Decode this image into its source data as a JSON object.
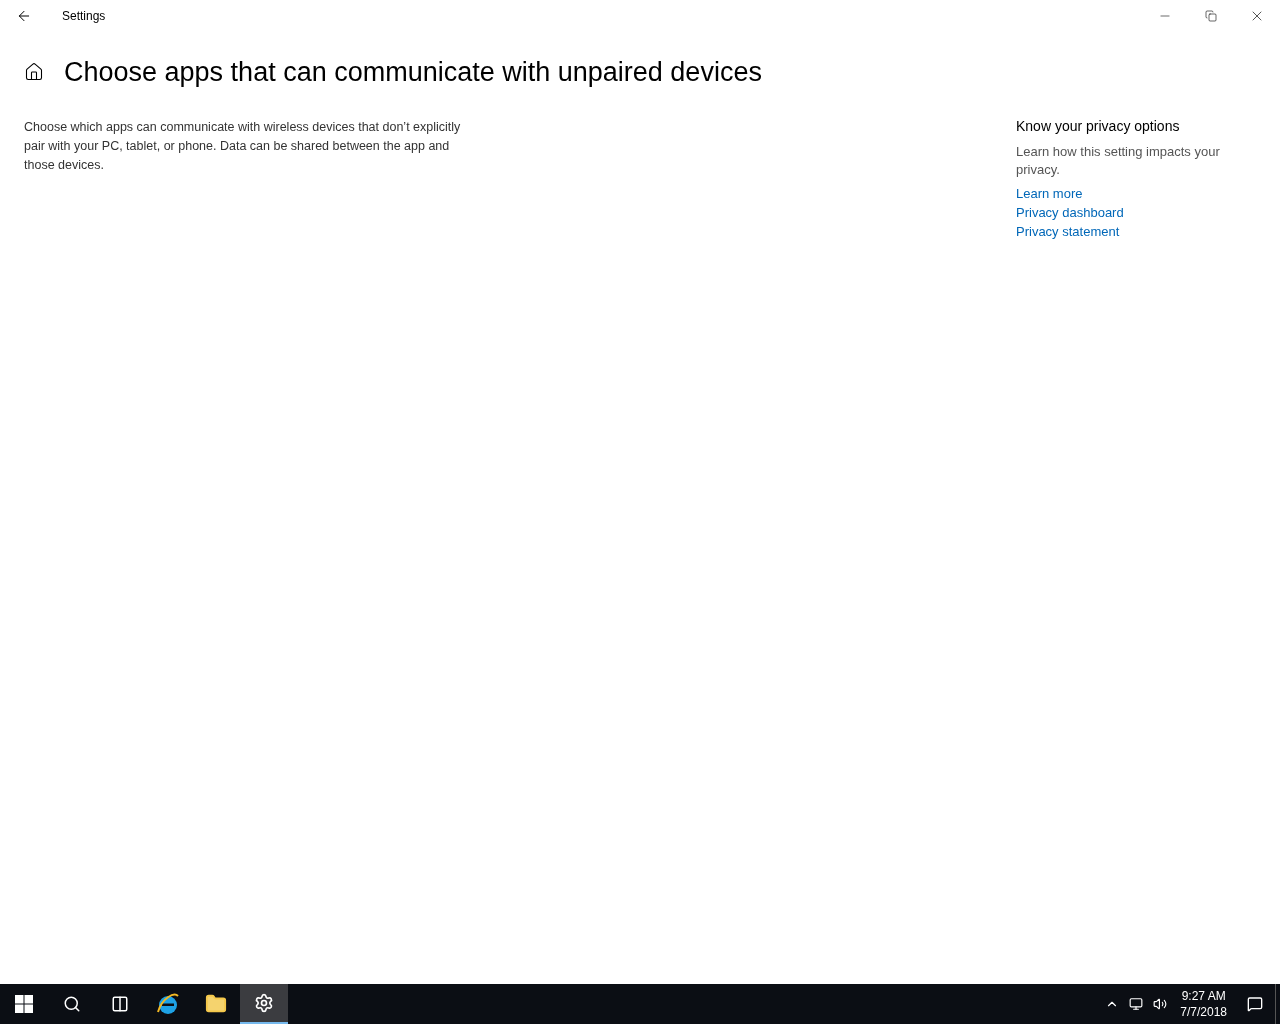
{
  "window": {
    "title": "Settings"
  },
  "page": {
    "title": "Choose apps that can communicate with unpaired devices",
    "description": "Choose which apps can communicate with wireless devices that don’t explicitly pair with your PC, tablet, or phone. Data can be shared between the app and those devices."
  },
  "privacy": {
    "heading": "Know your privacy options",
    "text": "Learn how this setting impacts your privacy.",
    "links": [
      "Learn more",
      "Privacy dashboard",
      "Privacy statement"
    ]
  },
  "taskbar": {
    "apps": [
      {
        "kind": "start",
        "selected": false
      },
      {
        "kind": "search",
        "selected": false
      },
      {
        "kind": "taskview",
        "selected": false
      },
      {
        "kind": "browser",
        "selected": false
      },
      {
        "kind": "folder",
        "selected": false
      },
      {
        "kind": "settings",
        "selected": true
      }
    ],
    "time": "9:27 AM",
    "date": "7/7/2018"
  }
}
